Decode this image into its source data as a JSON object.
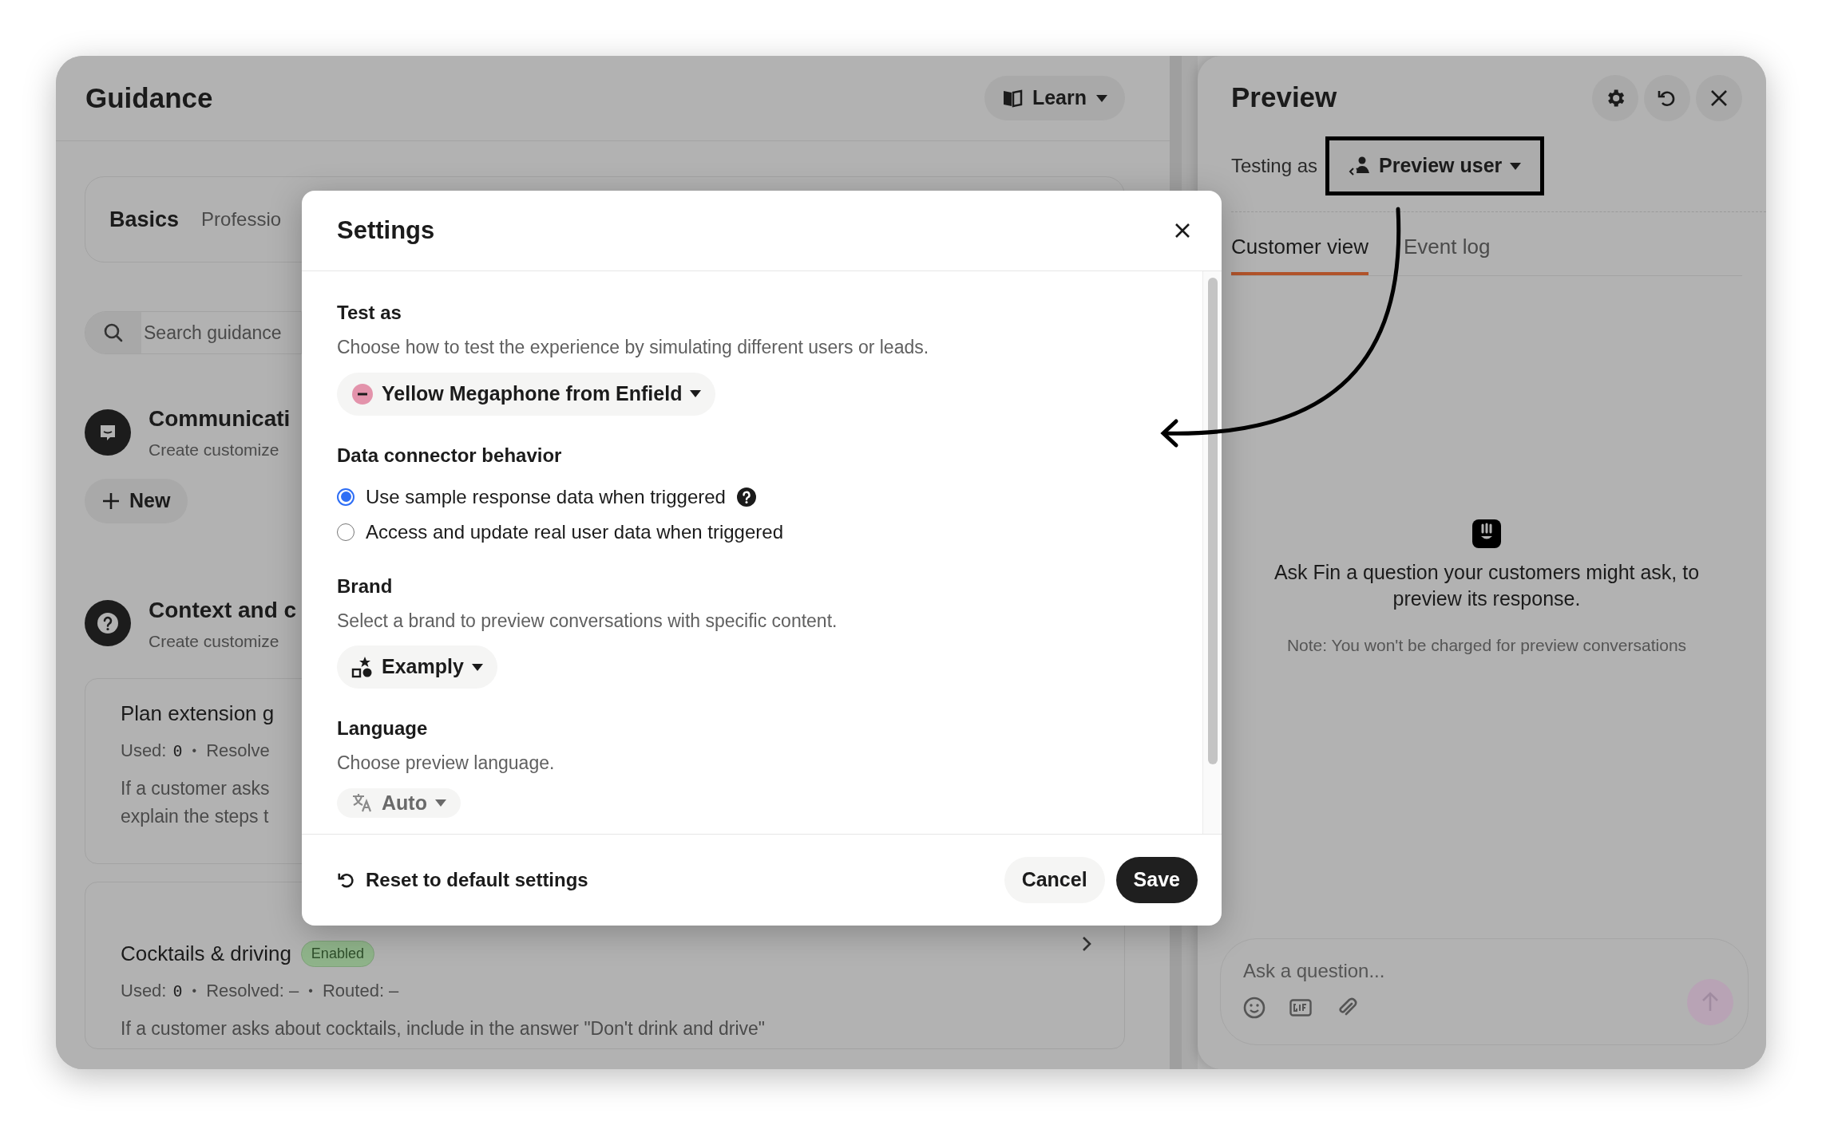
{
  "guidance": {
    "title": "Guidance",
    "learn_button": "Learn",
    "tabs": [
      {
        "label": "Basics",
        "selected": true
      },
      {
        "label": "Professio",
        "selected": false
      }
    ],
    "search": {
      "placeholder": "Search guidance"
    },
    "sections": [
      {
        "kind": "communication",
        "title": "Communicati",
        "subtitle": "Create customize",
        "new_button": "New"
      },
      {
        "kind": "context",
        "title": "Context and c",
        "subtitle": "Create customize"
      }
    ],
    "cards": [
      {
        "title": "Plan extension g",
        "stats": [
          {
            "kind": "label",
            "text": "Used:"
          },
          {
            "kind": "value",
            "text": "0"
          },
          {
            "kind": "dot",
            "text": "•"
          },
          {
            "kind": "label",
            "text": "Resolve"
          }
        ],
        "lines": [
          "If a customer asks",
          "explain the steps t"
        ]
      },
      {
        "title": "Cocktails & driving",
        "badge": "Enabled",
        "stats": [
          {
            "kind": "label",
            "text": "Used:"
          },
          {
            "kind": "value",
            "text": "0"
          },
          {
            "kind": "dot",
            "text": "•"
          },
          {
            "kind": "label",
            "text": "Resolved: –"
          },
          {
            "kind": "dot",
            "text": "•"
          },
          {
            "kind": "label",
            "text": "Routed: –"
          }
        ],
        "lines": [
          "If a customer asks about cocktails, include in the answer \"Don't drink and drive\""
        ]
      }
    ]
  },
  "preview": {
    "title": "Preview",
    "testing_label": "Testing as",
    "user_button": "Preview user",
    "tabs": [
      {
        "label": "Customer view",
        "selected": true
      },
      {
        "label": "Event log",
        "selected": false
      }
    ],
    "empty_title": "Ask Fin a question your customers might ask, to preview its response.",
    "note": "Note: You won't be charged for preview conversations",
    "composer": {
      "placeholder": "Ask a question..."
    }
  },
  "settings": {
    "title": "Settings",
    "sections": [
      {
        "kind": "user-select",
        "heading": "Test as",
        "description": "Choose how to test the experience by simulating different users or leads.",
        "value": "Yellow Megaphone from Enfield"
      },
      {
        "kind": "radio",
        "heading": "Data connector behavior",
        "options": [
          {
            "label": "Use sample response data when triggered",
            "selected": true,
            "help": true
          },
          {
            "label": "Access and update real user data when triggered",
            "selected": false,
            "help": false
          }
        ]
      },
      {
        "kind": "brand-select",
        "heading": "Brand",
        "description": "Select a brand to preview conversations with specific content.",
        "value": "Examply"
      },
      {
        "kind": "language-select",
        "heading": "Language",
        "description": "Choose preview language.",
        "value": "Auto"
      }
    ],
    "reset_button": "Reset to default settings",
    "cancel_button": "Cancel",
    "save_button": "Save"
  }
}
